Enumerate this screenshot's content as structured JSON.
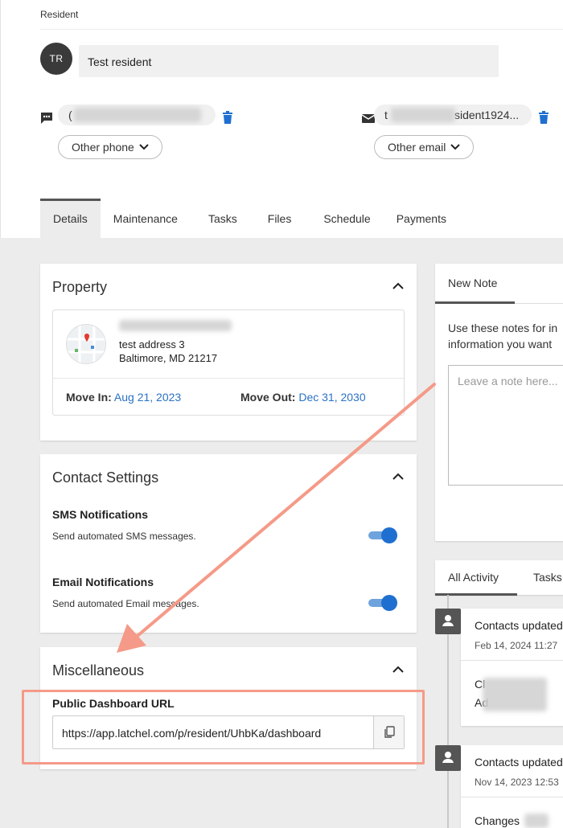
{
  "header": {
    "section_label": "Resident",
    "avatar_initials": "TR",
    "name_value": "Test resident"
  },
  "contact": {
    "phone_value": "(",
    "phone_dropdown": "Other phone",
    "email_value_start": "t",
    "email_value_end": "sident1924...",
    "email_dropdown": "Other email"
  },
  "tabs": [
    "Details",
    "Maintenance",
    "Tasks",
    "Files",
    "Schedule",
    "Payments"
  ],
  "property": {
    "title": "Property",
    "address_line2": "test address 3",
    "address_line3": "Baltimore, MD 21217",
    "move_in_label": "Move In:",
    "move_in_value": "Aug 21, 2023",
    "move_out_label": "Move Out:",
    "move_out_value": "Dec 31, 2030"
  },
  "contact_settings": {
    "title": "Contact Settings",
    "sms_title": "SMS Notifications",
    "sms_desc": "Send automated SMS messages.",
    "sms_enabled": true,
    "email_title": "Email Notifications",
    "email_desc": "Send automated Email messages.",
    "email_enabled": true
  },
  "misc": {
    "title": "Miscellaneous",
    "url_label": "Public Dashboard URL",
    "url_value": "https://app.latchel.com/p/resident/UhbKa/dashboard"
  },
  "note": {
    "tab_label": "New Note",
    "desc_line1": "Use these notes for in",
    "desc_line2": "information you want",
    "placeholder": "Leave a note here..."
  },
  "activity": {
    "tabs": [
      "All Activity",
      "Tasks"
    ],
    "items": [
      {
        "title": "Contacts updated",
        "date": "Feb 14, 2024 11:27",
        "line1": "Cl",
        "line2": "Ad"
      },
      {
        "title": "Contacts updated",
        "date": "Nov 14, 2023 12:53",
        "line1": "Changes"
      }
    ]
  },
  "colors": {
    "accent_blue": "#2a72c3",
    "annotation_red": "#f59a88"
  }
}
